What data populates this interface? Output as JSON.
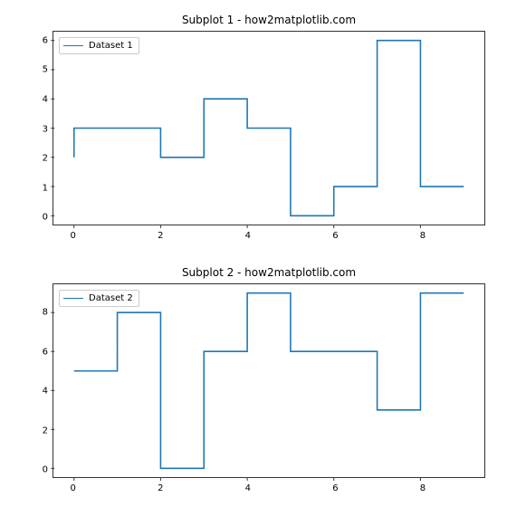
{
  "chart_data": [
    {
      "type": "line",
      "step": "pre",
      "title": "Subplot 1 - how2matplotlib.com",
      "xlabel": "",
      "ylabel": "",
      "x": [
        0,
        1,
        2,
        3,
        4,
        5,
        6,
        7,
        8,
        9
      ],
      "values": [
        2,
        3,
        3,
        2,
        4,
        3,
        0,
        1,
        6,
        1
      ],
      "xticks": [
        0,
        2,
        4,
        6,
        8
      ],
      "yticks": [
        0,
        1,
        2,
        3,
        4,
        5,
        6
      ],
      "xlim": [
        -0.45,
        9.45
      ],
      "ylim": [
        -0.3,
        6.3
      ],
      "legend": "Dataset 1",
      "line_color": "#1f77b4"
    },
    {
      "type": "line",
      "step": "pre",
      "title": "Subplot 2 - how2matplotlib.com",
      "xlabel": "",
      "ylabel": "",
      "x": [
        0,
        1,
        2,
        3,
        4,
        5,
        6,
        7,
        8,
        9
      ],
      "values": [
        5,
        5,
        8,
        0,
        6,
        9,
        6,
        6,
        3,
        9
      ],
      "xticks": [
        0,
        2,
        4,
        6,
        8
      ],
      "yticks": [
        0,
        2,
        4,
        6,
        8
      ],
      "xlim": [
        -0.45,
        9.45
      ],
      "ylim": [
        -0.45,
        9.45
      ],
      "legend": "Dataset 2",
      "line_color": "#1f77b4"
    }
  ]
}
